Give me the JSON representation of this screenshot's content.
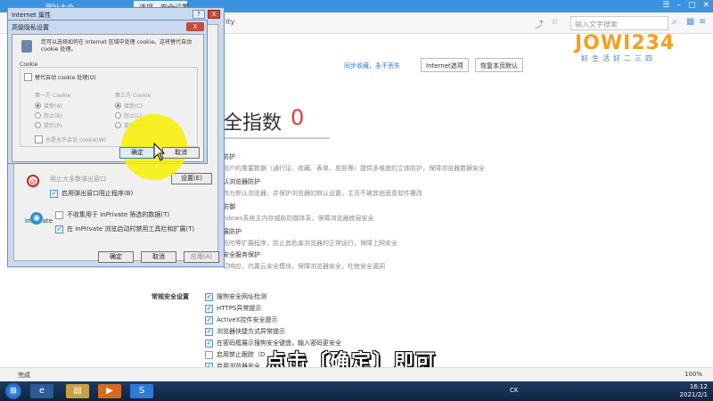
{
  "browser": {
    "tabs": [
      "网址大全",
      "选项 - 安全设置"
    ],
    "url": "rity",
    "search_placeholder": "输入文字搜索",
    "status": "完成",
    "zoom": "100%"
  },
  "page": {
    "logo": "JOWI234",
    "slogan": "好生活好二三四",
    "sync_text": "同步收藏，永不丢失",
    "btn_internet": "Internet选项",
    "btn_restore": "恢复本页默认",
    "score_title": "全指数",
    "score_value": "0",
    "features": [
      {
        "title": "防护",
        "desc": "用户的重要数据（通行证、收藏、表单、皮肤等）提供多维度的立体防护，保障浏览器数据安全"
      },
      {
        "title": "认浏览器防护",
        "desc": "改为默认浏览器，并保护浏览器的默认设置，主页不被其他恶意软件篡改"
      },
      {
        "title": "防御",
        "desc": "ndows系统主内存威胁防御体系，保障浏览器底层安全"
      },
      {
        "title": "展防护",
        "desc": "危险等扩展程序，防止其危害浏览器的正常运行，保障上网安全"
      },
      {
        "title": "安全服务保护",
        "desc": "切响应，内置云安全模块，保障浏览器安全，杜绝安全漏洞"
      }
    ],
    "section_label": "常规安全设置",
    "checks": [
      {
        "label": "搜狗安全网址检测",
        "checked": true
      },
      {
        "label": "HTTPS异常提示",
        "checked": true
      },
      {
        "label": "ActiveX控件安全提示",
        "checked": true
      },
      {
        "label": "浏览器快捷方式异常提示",
        "checked": true
      },
      {
        "label": "在密码框展示搜狗安全键盘，输入密码更安全",
        "checked": true
      },
      {
        "label": "启用禁止跟踪（D",
        "checked": false
      },
      {
        "label": "启用浏览器安全",
        "checked": true
      }
    ],
    "caption": "点击〔确定〕即可"
  },
  "dialog_main": {
    "title": "Internet 属性",
    "ctrl_help": "?",
    "ctrl_close": "X",
    "popup_text": "阻止大多数弹出窗口",
    "settings_btn": "设置(E)",
    "popup_blocker": "启用弹出窗口阻止程序(B)",
    "inprivate_label": "InPrivate",
    "inprivate_row1": "不收集用于 InPrivate 筛选的数据(T)",
    "inprivate_row2": "在 InPrivate 浏览启动时禁用工具栏和扩展(T)",
    "btn_ok": "确定",
    "btn_cancel": "取消",
    "btn_apply": "应用(A)"
  },
  "dialog_adv": {
    "title": "高级隐私设置",
    "close": "X",
    "desc": "您可以选择如何在 Internet 区域中处理 cookie。这将替代自动 cookie 处理。",
    "cookie_label": "Cookie",
    "override": "替代自动 cookie 处理(O)",
    "first_party": "第一方 Cookie",
    "third_party": "第三方 Cookie",
    "first_options": [
      "接受(A)",
      "阻止(B)",
      "提示(P)"
    ],
    "third_options": [
      "接受(C)",
      "阻止(L)",
      "提示(R)"
    ],
    "session": "总是允许会话 cookie(W)",
    "ok": "确定",
    "cancel": "取消"
  },
  "taskbar": {
    "tray_lang": "CK",
    "time": "16:12",
    "date": "2021/2/1"
  }
}
